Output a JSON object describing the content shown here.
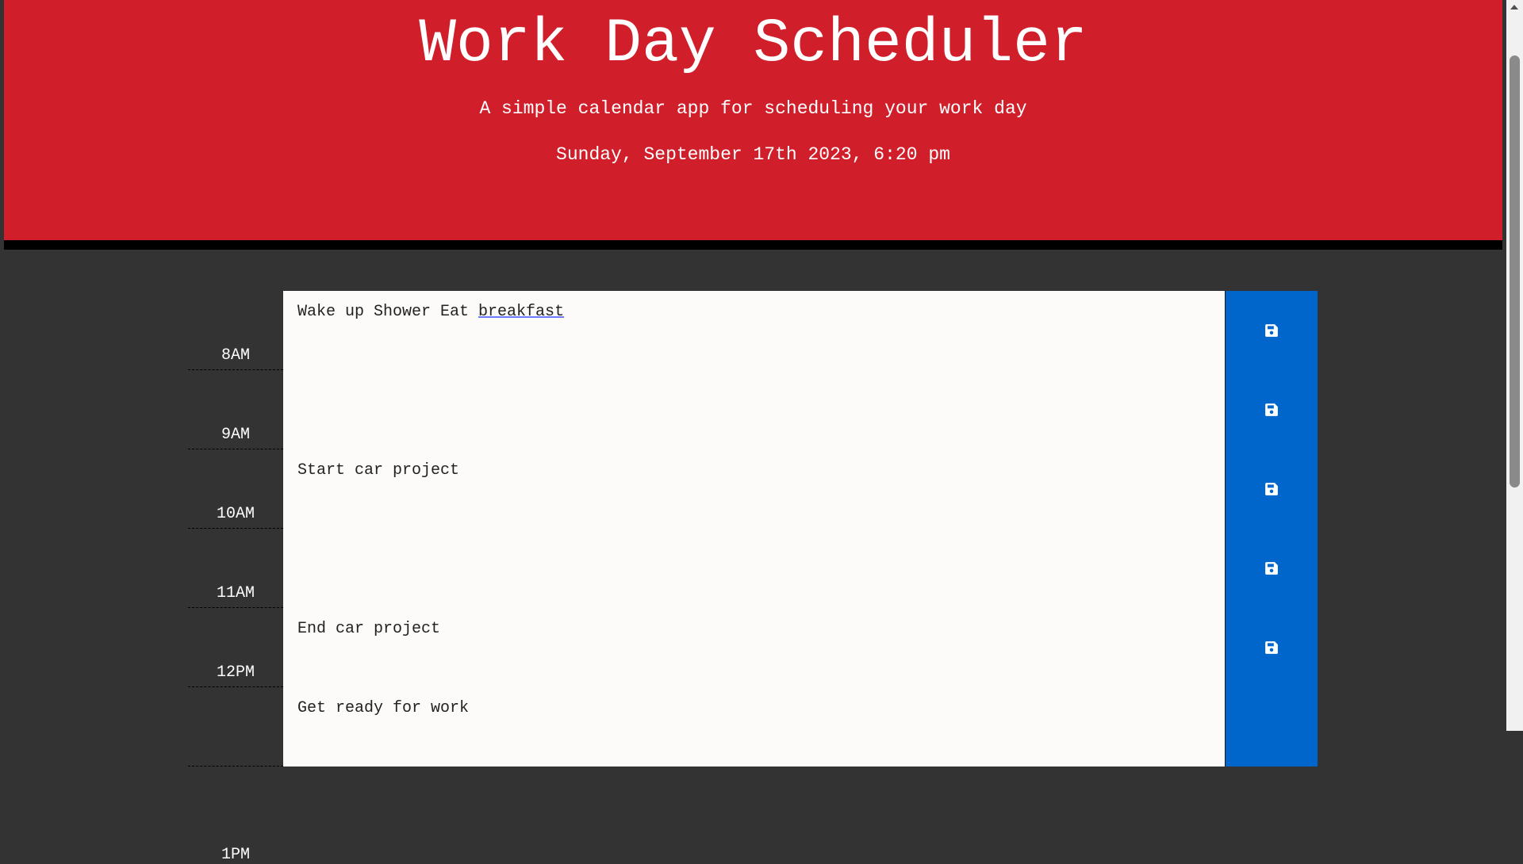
{
  "header": {
    "title": "Work Day Scheduler",
    "subtitle": "A simple calendar app for scheduling your work day",
    "current_date": "Sunday, September 17th 2023, 6:20 pm"
  },
  "colors": {
    "header_bg": "#d01f2a",
    "page_bg": "#333333",
    "textarea_bg": "#fcfbf9",
    "save_bg": "#0066cc"
  },
  "time_blocks": [
    {
      "hour": "8AM",
      "text_before": "Wake up Shower Eat ",
      "text_spell": "breakfast"
    },
    {
      "hour": "9AM",
      "text": ""
    },
    {
      "hour": "10AM",
      "text": "Start car project"
    },
    {
      "hour": "11AM",
      "text": ""
    },
    {
      "hour": "12PM",
      "text": "End car project"
    },
    {
      "hour": "1PM",
      "text": "Get ready for work"
    }
  ],
  "save_icon": "floppy-disk-icon"
}
